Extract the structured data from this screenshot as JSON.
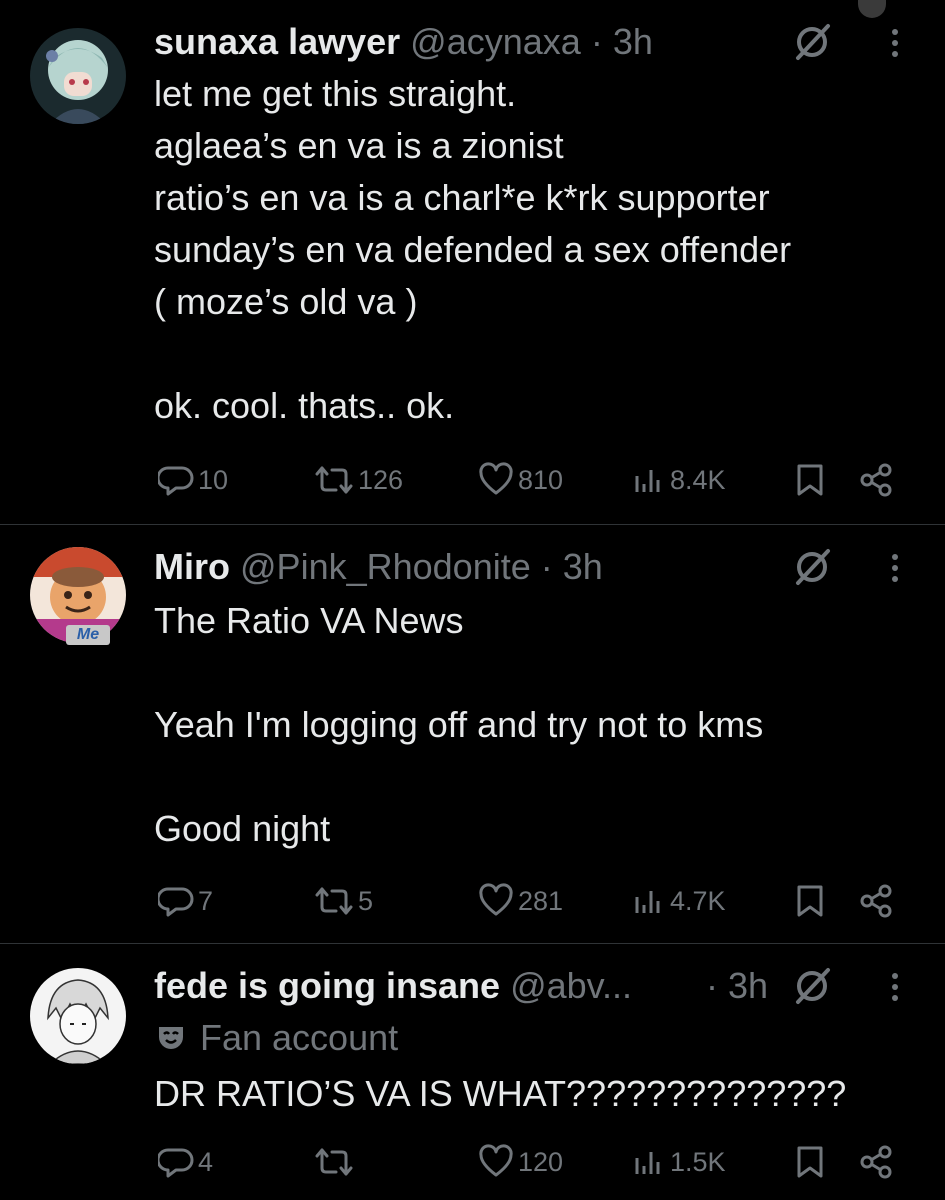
{
  "tweets": [
    {
      "name": "sunaxa lawyer",
      "handle": "@acynaxa",
      "time": "· 3h",
      "lines": [
        "let me get this straight.",
        "aglaea’s en va is a zionist",
        "ratio’s en va is a charl*e k*rk supporter",
        "sunday’s en va defended a sex offender",
        "( moze’s old va )",
        "",
        "ok. cool. thats.. ok."
      ],
      "replies": "10",
      "reposts": "126",
      "likes": "810",
      "views": "8.4K",
      "avatar_color": "#9fc7c0"
    },
    {
      "name": "Miro",
      "handle": "@Pink_Rhodonite",
      "time": "· 3h",
      "lines": [
        "The Ratio VA News",
        "",
        "Yeah I'm logging off and try not to kms",
        "",
        "Good night"
      ],
      "replies": "7",
      "reposts": "5",
      "likes": "281",
      "views": "4.7K",
      "avatar_badge": "Me",
      "avatar_color": "#e07b4a"
    },
    {
      "name": "fede is going insane",
      "handle": "@abv...",
      "time": "· 3h",
      "label": "Fan account",
      "lines": [
        "DR RATIO’S VA IS WHAT??????????????"
      ],
      "replies": "4",
      "reposts": "",
      "likes": "120",
      "views": "1.5K",
      "avatar_color": "#f2f2f2"
    }
  ],
  "icons": {
    "reply": "reply-icon",
    "repost": "repost-icon",
    "like": "heart-icon",
    "views": "views-icon",
    "bookmark": "bookmark-icon",
    "share": "share-icon",
    "grok": "grok-icon",
    "more": "more-icon"
  },
  "colors": {
    "background": "#000000",
    "text": "#e7e9ea",
    "muted": "#71767b",
    "divider": "#2f3336"
  }
}
